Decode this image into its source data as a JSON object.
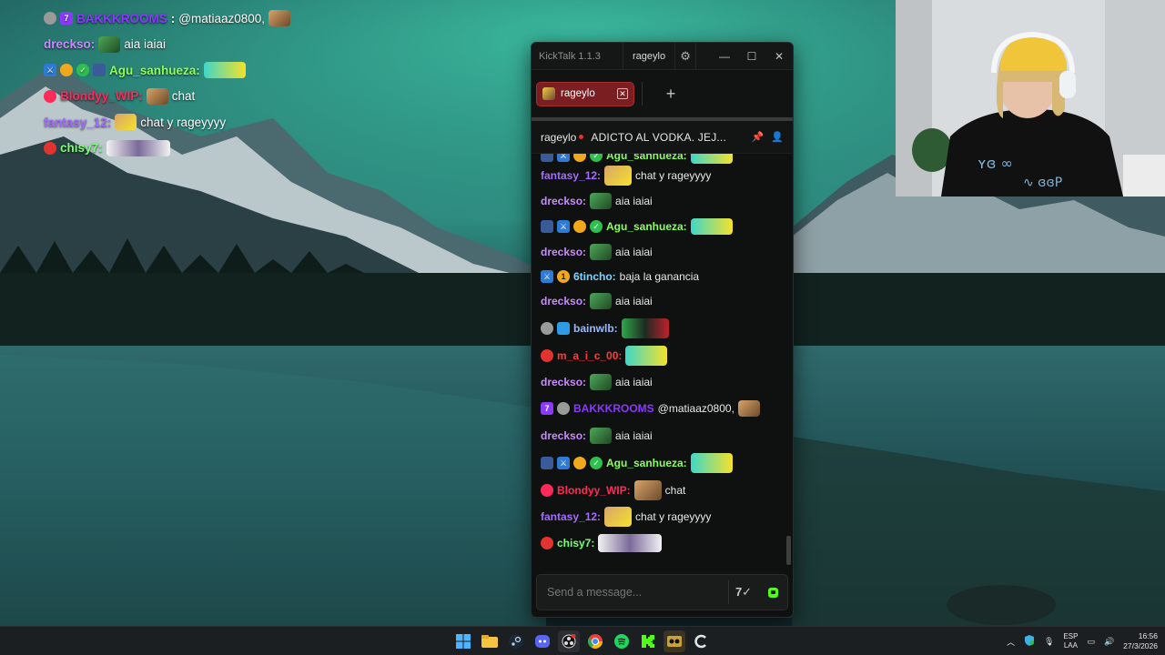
{
  "overlay": {
    "rows": [
      {
        "user": "BAKKKROOMS",
        "msg": "@matiaaz0800,",
        "color": "#8b38ff"
      },
      {
        "user": "dreckso:",
        "msg": "aia iaiai",
        "color": "#c98bff"
      },
      {
        "user": "Agu_sanhueza:",
        "msg": "",
        "color": "#8bff58"
      },
      {
        "user": "Blondyy_WIP:",
        "msg": "chat",
        "color": "#ff2a5a"
      },
      {
        "user": "fantasy_12:",
        "msg": "chat y rageyyyy",
        "color": "#a56bff"
      },
      {
        "user": "chisy7:",
        "msg": "",
        "color": "#78ff78"
      }
    ]
  },
  "kicktalk": {
    "app_title": "KickTalk 1.1.3",
    "user": "rageylo",
    "tab": {
      "label": "rageylo",
      "close": "✕"
    },
    "add_tab": "+",
    "channel": {
      "name": "rageylo",
      "title": "ADICTO AL VODKA. JEJ..."
    },
    "messages": [
      {
        "user": "Agu_sanhueza:",
        "msg": "",
        "color": "#8bff58"
      },
      {
        "user": "fantasy_12:",
        "msg": "chat y rageyyyy",
        "color": "#a56bff"
      },
      {
        "user": "dreckso:",
        "msg": "aia iaiai",
        "color": "#c98bff"
      },
      {
        "user": "Agu_sanhueza:",
        "msg": "",
        "color": "#8bff58"
      },
      {
        "user": "dreckso:",
        "msg": "aia iaiai",
        "color": "#c98bff"
      },
      {
        "user": "6tincho:",
        "msg": "baja la ganancia",
        "color": "#7fd4ff"
      },
      {
        "user": "dreckso:",
        "msg": "aia iaiai",
        "color": "#c98bff"
      },
      {
        "user": "bainwlb:",
        "msg": "",
        "color": "#9ab8ff"
      },
      {
        "user": "m_a_i_c_00:",
        "msg": "",
        "color": "#ff3b3b"
      },
      {
        "user": "dreckso:",
        "msg": "aia iaiai",
        "color": "#c98bff"
      },
      {
        "user": "BAKKKROOMS",
        "msg": "@matiaaz0800,",
        "color": "#8b38ff"
      },
      {
        "user": "dreckso:",
        "msg": "aia iaiai",
        "color": "#c98bff"
      },
      {
        "user": "Agu_sanhueza:",
        "msg": "",
        "color": "#8bff58"
      },
      {
        "user": "Blondyy_WIP:",
        "msg": "chat",
        "color": "#ff2a5a"
      },
      {
        "user": "fantasy_12:",
        "msg": "chat y rageyyyy",
        "color": "#a56bff"
      },
      {
        "user": "chisy7:",
        "msg": "",
        "color": "#78ff78"
      }
    ],
    "input_placeholder": "Send a message...",
    "emote_button": "7✓"
  },
  "taskbar": {
    "lang_top": "ESP",
    "lang_bottom": "LAA",
    "time": "16:56",
    "date": "27/3/2026"
  },
  "colors": {
    "kick_green": "#53fc18",
    "tab_red": "#7a1e22",
    "live_dot": "#e2342f"
  }
}
